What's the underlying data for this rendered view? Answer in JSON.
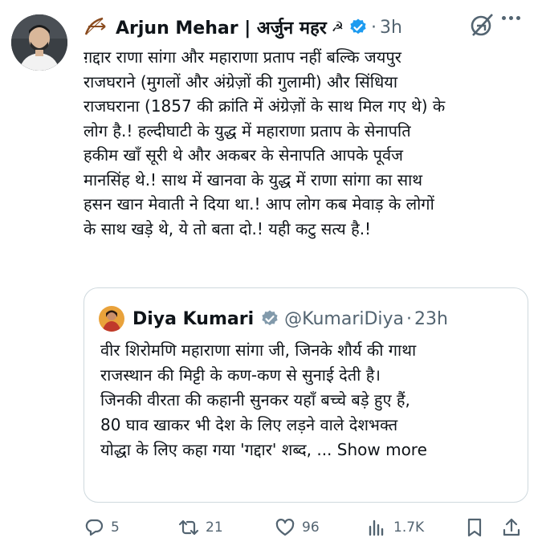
{
  "author": {
    "display_name": "Arjun Mehar | अर्जुन महर ☭",
    "name_text": "Arjun Mehar | अर्जुन महर",
    "hammer": "☭",
    "separator": "·",
    "time": "3h"
  },
  "tweet": {
    "text": "ग़द्दार राणा सांगा और महाराणा प्रताप नहीं बल्कि जयपुर\nराजघराने (मुगलों और अंग्रेज़ों की गुलामी) और सिंधिया\nराजघराना (1857 की क्रांति में अंग्रेज़ों के साथ मिल गए थे) के\nलोग है.! हल्दीघाटी के युद्ध में महाराणा प्रताप के सेनापति\nहकीम खाँ सूरी थे और अकबर के सेनापति आपके पूर्वज\nमानसिंह थे.! साथ में खानवा के युद्ध में राणा सांगा का साथ\nहसन खान मेवाती ने दिया था.! आप लोग कब मेवाड़ के लोगों\nके साथ खड़े थे, ये तो बता दो.! यही कटु सत्य है.!"
  },
  "quote": {
    "name": "Diya Kumari",
    "handle": "@KumariDiya",
    "separator": "·",
    "time": "23h",
    "text": "वीर शिरोमणि महाराणा सांगा जी, जिनके शौर्य की गाथा\nराजस्थान की मिट्टी के कण-कण से सुनाई देती है।\nजिनकी वीरता की कहानी सुनकर यहाँ बच्चे बड़े हुए हैं,\n80 घाव खाकर भी देश के लिए लड़ने वाले देशभक्त\nयोद्धा के लिए कहा गया 'गद्दार' शब्द, ... ",
    "show_more": "Show more"
  },
  "actions": {
    "replies": "5",
    "reposts": "21",
    "likes": "96",
    "views": "1.7K"
  },
  "colors": {
    "verified": "#1d9bf0",
    "muted": "#536471",
    "border": "#cfd9de",
    "text": "#0f1419"
  },
  "icons": [
    "archer-emblem-icon",
    "verified-badge-icon",
    "grok-icon",
    "more-icon",
    "reply-icon",
    "repost-icon",
    "like-icon",
    "views-icon",
    "bookmark-icon",
    "share-icon"
  ]
}
